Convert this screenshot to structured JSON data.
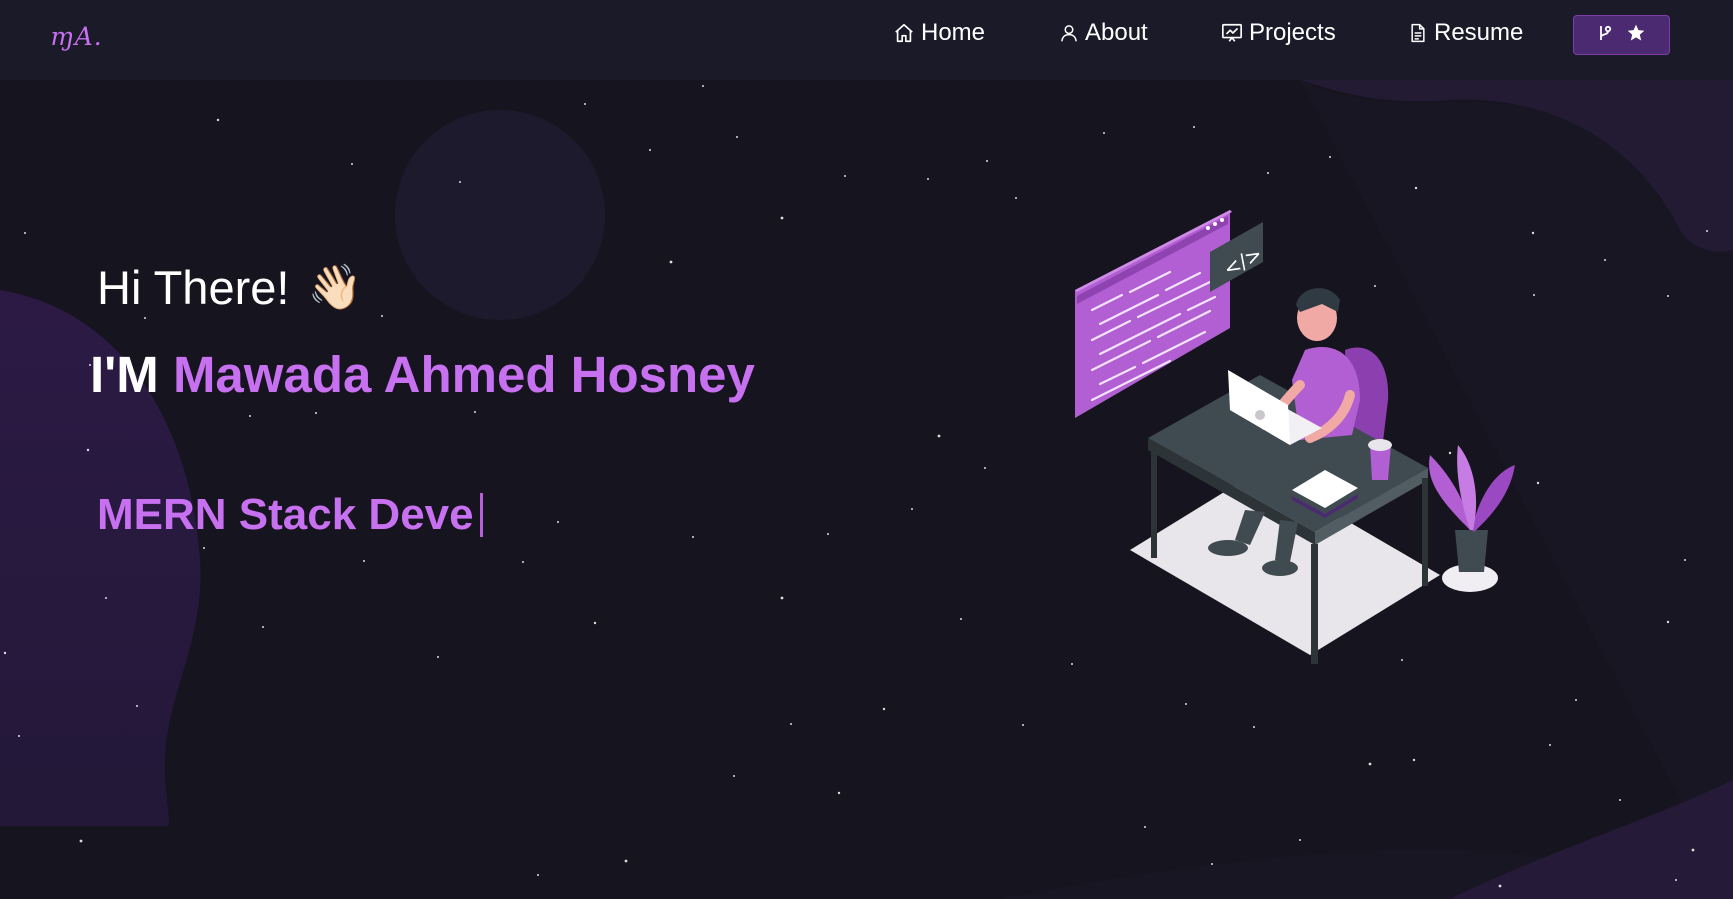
{
  "brand": {
    "logo_text": "ɱA."
  },
  "nav": {
    "items": [
      {
        "label": "Home",
        "icon": "home-icon"
      },
      {
        "label": "About",
        "icon": "user-icon"
      },
      {
        "label": "Projects",
        "icon": "projects-icon"
      },
      {
        "label": "Resume",
        "icon": "document-icon"
      }
    ],
    "github_button": {
      "icons": [
        "git-fork-icon",
        "star-icon"
      ]
    }
  },
  "hero": {
    "greeting": "Hi There!",
    "wave_emoji": "👋🏻",
    "intro_prefix": "I'M",
    "name": "Mawada Ahmed Hosney",
    "typed_text": "MERN Stack Deve"
  },
  "colors": {
    "accent": "#c770f0",
    "background": "#16141e",
    "navbar": "#1b1a29",
    "button": "#4c2a72"
  }
}
